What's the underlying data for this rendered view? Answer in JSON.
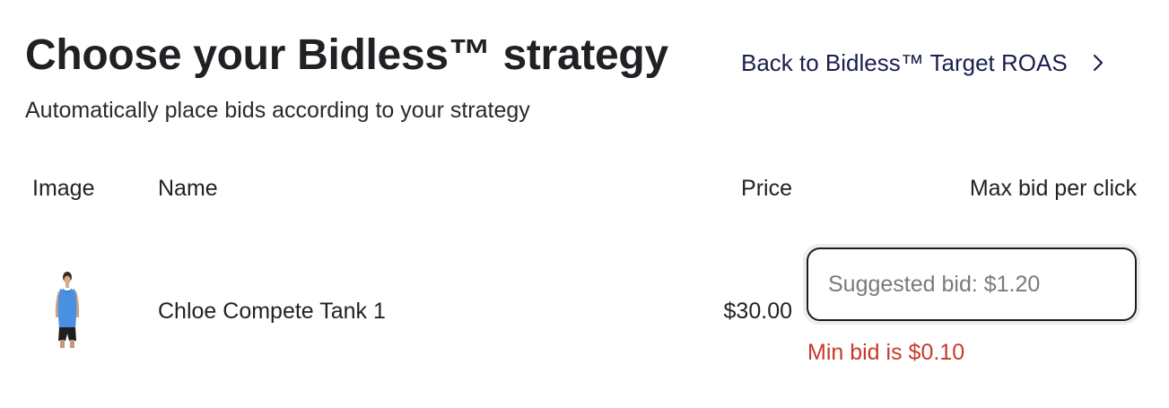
{
  "header": {
    "title": "Choose your Bidless™ strategy",
    "subtitle": "Automatically place bids according to your strategy",
    "back_link": "Back to Bidless™ Target ROAS",
    "back_icon": "chevron-right-icon"
  },
  "table": {
    "columns": [
      "Image",
      "Name",
      "Price",
      "Max bid per click"
    ],
    "rows": [
      {
        "image_icon": "product-thumbnail",
        "name": "Chloe Compete Tank 1",
        "price": "$30.00",
        "bid_placeholder": "Suggested bid: $1.20",
        "bid_value": "",
        "error": "Min bid is $0.10"
      }
    ]
  },
  "colors": {
    "link": "#1a1f4b",
    "error": "#c73a2a",
    "tank": "#4a90e2"
  }
}
